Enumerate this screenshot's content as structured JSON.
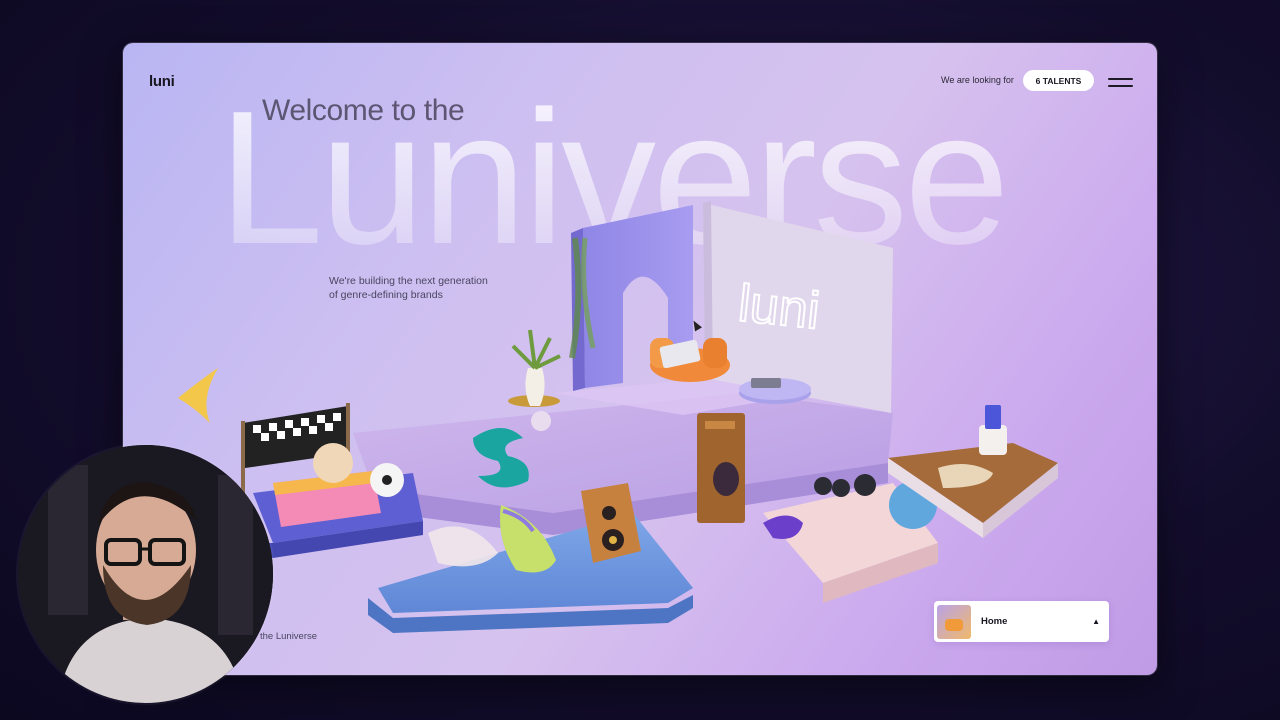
{
  "header": {
    "logo": "luni",
    "looking_text": "We are looking for",
    "talents_button": "6 TALENTS",
    "menu_icon": "hamburger-menu-icon"
  },
  "hero": {
    "welcome": "Welcome to the",
    "big_title": "Luniverse",
    "tagline_line1": "We're building the next generation",
    "tagline_line2": "of genre-defining brands",
    "sign_text": "luni"
  },
  "footer": {
    "caption": "the Luniverse"
  },
  "nav": {
    "label": "Home",
    "caret": "▲"
  },
  "colors": {
    "bg_dark": "#130d2c",
    "frame_lavender": "#cdbff1",
    "accent_purple": "#8f7ae0",
    "text_dark": "#17151f"
  }
}
